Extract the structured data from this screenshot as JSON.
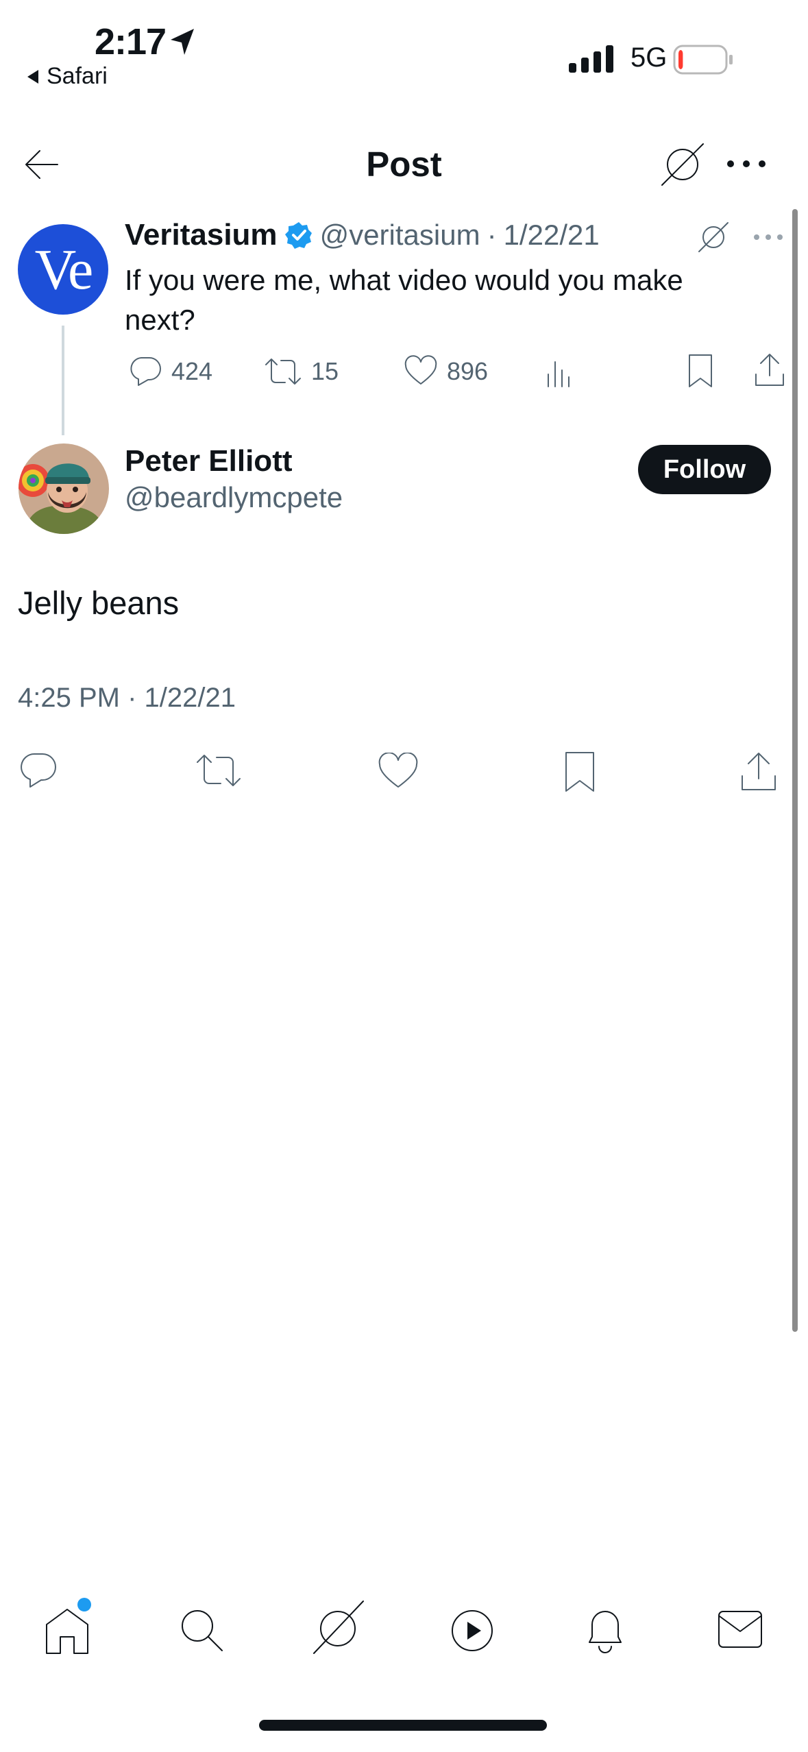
{
  "status_bar": {
    "time": "2:17",
    "back_app": "Safari",
    "network": "5G",
    "battery_level": 0.1,
    "battery_color": "#ff3b30"
  },
  "header": {
    "title": "Post"
  },
  "parent_tweet": {
    "author_name": "Veritasium",
    "avatar_text": "Ve",
    "handle": "@veritasium",
    "separator": "·",
    "date": "1/22/21",
    "text_line1": "If you were me, what video would you make",
    "text_line2": "next?",
    "replies": "424",
    "retweets": "15",
    "likes": "896"
  },
  "main_tweet": {
    "author_name": "Peter Elliott",
    "handle": "@beardlymcpete",
    "follow_label": "Follow",
    "text": "Jelly beans",
    "timestamp": "4:25 PM · 1/22/21"
  },
  "colors": {
    "accent": "#1d9bf0",
    "text": "#0f1419",
    "muted": "#536471",
    "avatar_blue": "#1d4fd8"
  },
  "icons": [
    "back-arrow-icon",
    "grok-icon",
    "more-icon",
    "verified-icon",
    "reply-icon",
    "retweet-icon",
    "like-icon",
    "views-icon",
    "bookmark-icon",
    "share-icon",
    "home-icon",
    "search-icon",
    "play-icon",
    "bell-icon",
    "mail-icon"
  ]
}
